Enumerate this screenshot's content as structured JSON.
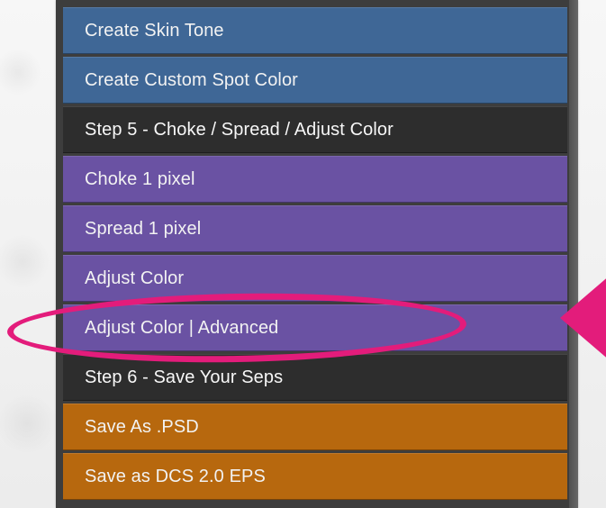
{
  "menu": {
    "items": [
      {
        "label": "Create Skin Tone",
        "variant": "blue"
      },
      {
        "label": "Create Custom Spot Color",
        "variant": "blue"
      },
      {
        "label": "Step 5 - Choke / Spread / Adjust Color",
        "variant": "dark"
      },
      {
        "label": "Choke 1 pixel",
        "variant": "purple"
      },
      {
        "label": "Spread 1 pixel",
        "variant": "purple"
      },
      {
        "label": "Adjust Color",
        "variant": "purple"
      },
      {
        "label": "Adjust Color | Advanced",
        "variant": "purple"
      },
      {
        "label": "Step 6 - Save Your Seps",
        "variant": "dark"
      },
      {
        "label": "Save As .PSD",
        "variant": "orange"
      },
      {
        "label": "Save as DCS 2.0 EPS",
        "variant": "orange"
      }
    ]
  },
  "colors": {
    "blue": "#3f6796",
    "purple": "#6a52a3",
    "dark": "#2d2d2d",
    "orange": "#b7680e",
    "highlight": "#e31c7b"
  },
  "annotations": {
    "highlight_shape": "ellipse",
    "pointer_icon": "arrow-left-icon"
  }
}
